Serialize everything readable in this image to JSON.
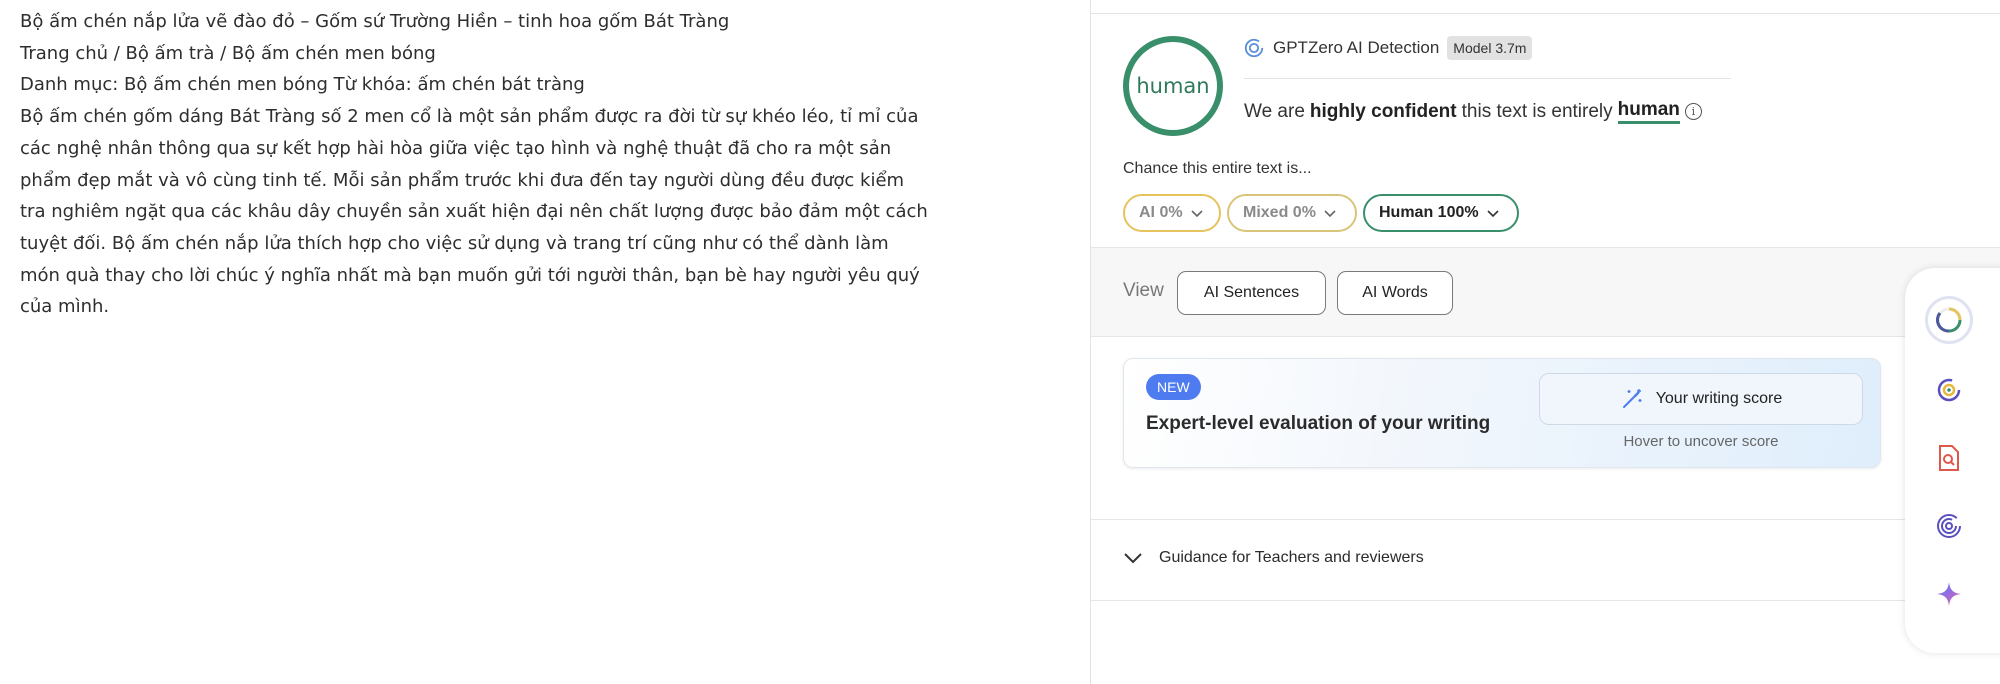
{
  "document": {
    "lines": [
      "Bộ ấm chén nắp lửa vẽ đào đỏ – Gốm sứ Trường Hiền – tinh hoa gốm Bát Tràng",
      "Trang chủ / Bộ ấm trà / Bộ ấm chén men bóng",
      "Danh mục: Bộ ấm chén men bóng Từ khóa: ấm chén bát tràng"
    ],
    "paragraph": "Bộ ấm chén gốm dáng Bát Tràng số 2 men cổ là một sản phẩm được ra đời từ sự khéo léo, tỉ mỉ của các nghệ nhân thông qua sự kết hợp hài hòa giữa việc tạo hình và nghệ thuật đã cho ra một sản phẩm đẹp mắt và vô cùng tinh tế. Mỗi sản phẩm trước khi đưa đến tay người dùng đều được kiểm tra nghiêm ngặt qua các khâu dây chuyền sản xuất hiện đại nên chất lượng được bảo đảm một cách tuyệt đối. Bộ ấm chén nắp lửa thích hợp cho việc sử dụng và trang trí cũng như có thể dành làm món quà thay cho lời chúc ý nghĩa nhất mà bạn muốn gửi tới người thân, bạn bè hay người yêu quý của mình."
  },
  "detection": {
    "result_label": "human",
    "title": "GPTZero AI Detection",
    "model_badge": "Model 3.7m",
    "verdict": {
      "prefix": "We are",
      "confidence": "highly confident",
      "middle": "this text is entirely",
      "result": "human"
    },
    "chance_label": "Chance this entire text is...",
    "pills": {
      "ai": "AI 0%",
      "mixed": "Mixed 0%",
      "human": "Human 100%"
    },
    "colors": {
      "human": "#3a8f6b",
      "ai": "#e6c35c",
      "mixed": "#d8c57a"
    }
  },
  "view": {
    "label": "View",
    "sentences_button": "AI Sentences",
    "words_button": "AI Words"
  },
  "promo": {
    "badge": "NEW",
    "text": "Expert-level evaluation of your writing",
    "button": "Your writing score",
    "hint": "Hover to uncover score"
  },
  "guidance": {
    "label": "Guidance for Teachers and reviewers"
  },
  "rail": {
    "items": [
      "progress-ring-icon",
      "gptzero-logo-icon",
      "document-search-icon",
      "spiral-icon",
      "sparkle-icon"
    ]
  }
}
